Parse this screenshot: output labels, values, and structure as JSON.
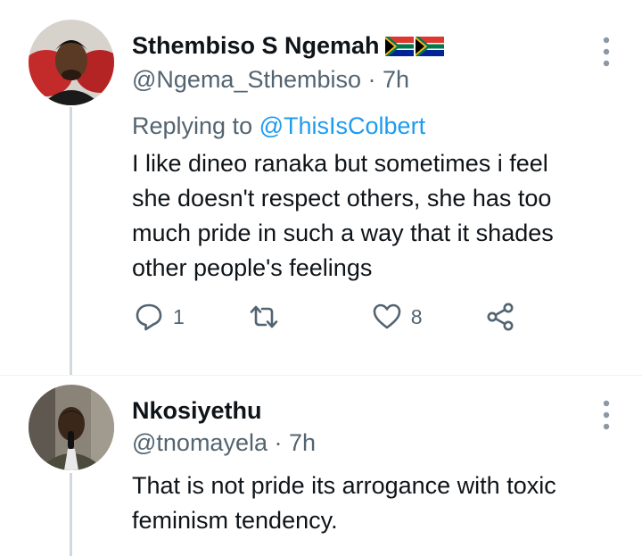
{
  "tweets": [
    {
      "display_name": "Sthembiso S Ngemah",
      "flags": [
        "south-africa-flag",
        "south-africa-flag"
      ],
      "handle": "@Ngema_Sthembiso",
      "time": "7h",
      "reply_prefix": "Replying to",
      "reply_mention": "@ThisIsColbert",
      "text_lines": [
        "I like dineo ranaka but sometimes i feel",
        "she doesn't respect others, she has too",
        "much pride in such a way that it shades",
        "other people's feelings"
      ],
      "reply_count": "1",
      "retweet_count": "",
      "like_count": "8"
    },
    {
      "display_name": "Nkosiyethu",
      "handle": "@tnomayela",
      "time": "7h",
      "text_lines": [
        "That is not pride its arrogance with toxic",
        "feminism tendency."
      ]
    }
  ],
  "separator": " · ",
  "colors": {
    "text": "#0f1419",
    "secondary": "#536471",
    "link": "#1d9bf0",
    "thread_line": "#cfd9de"
  }
}
